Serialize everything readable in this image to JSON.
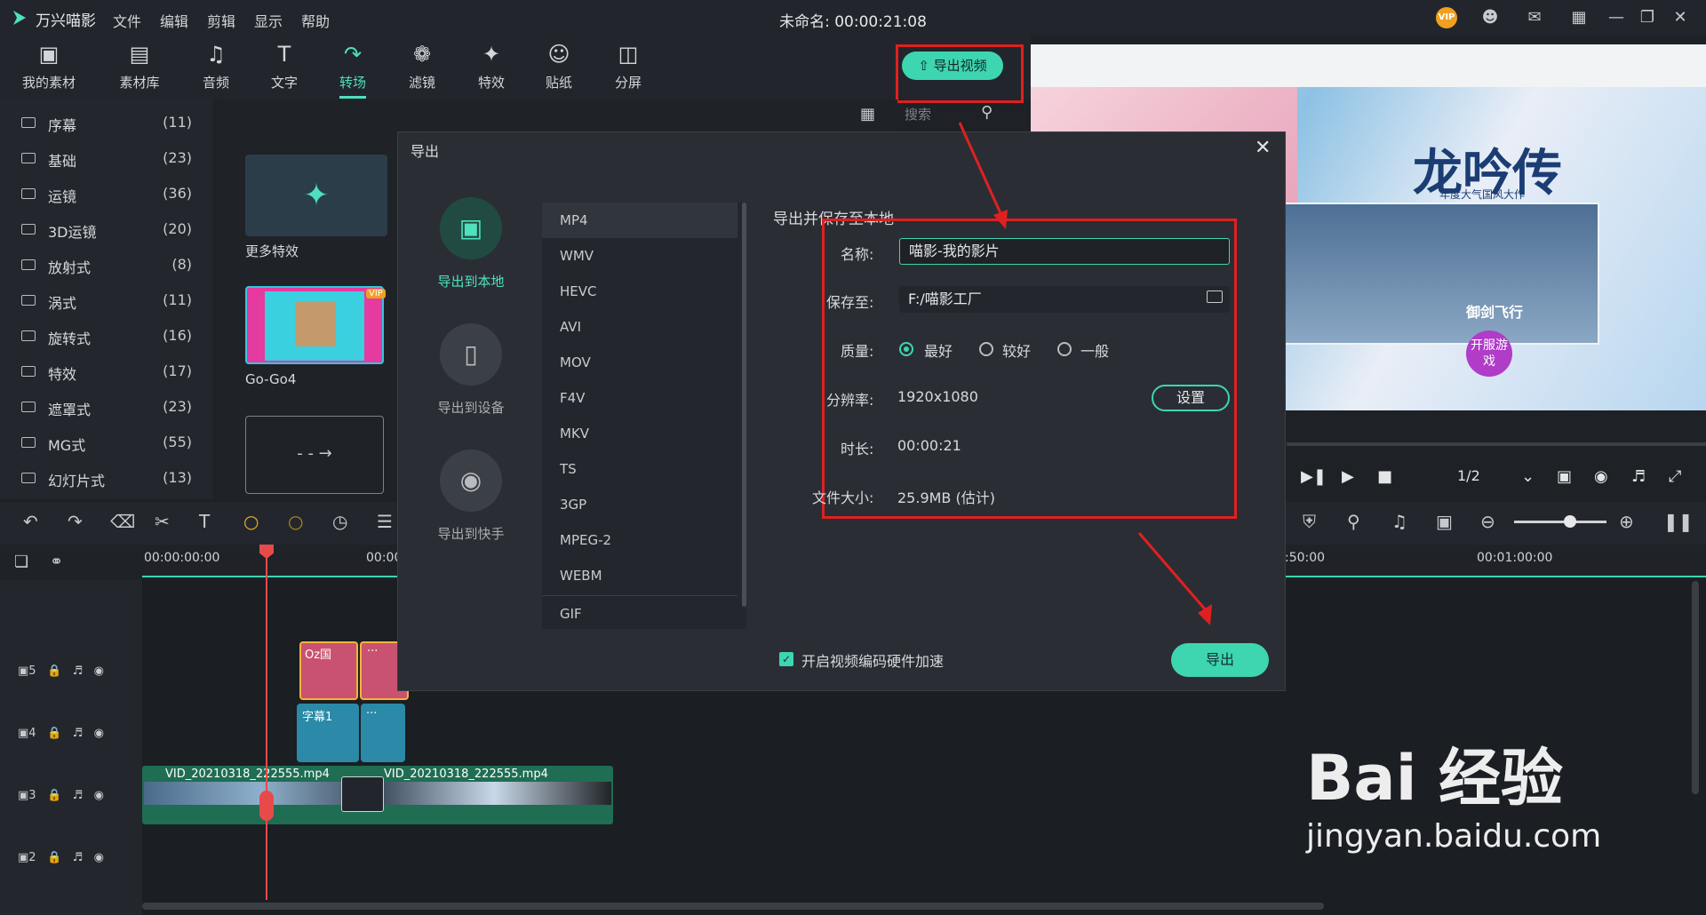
{
  "app": {
    "brand": "万兴喵影",
    "menu": [
      "文件",
      "编辑",
      "剪辑",
      "显示",
      "帮助"
    ],
    "title": "未命名: 00:00:21:08",
    "vip": "VIP"
  },
  "toolbar": {
    "items": [
      "我的素材",
      "素材库",
      "音频",
      "文字",
      "转场",
      "滤镜",
      "特效",
      "贴纸",
      "分屏"
    ],
    "active": "转场",
    "export_video": "导出视频",
    "search_placeholder": "搜索"
  },
  "categories": [
    {
      "name": "序幕",
      "count": "(11)"
    },
    {
      "name": "基础",
      "count": "(23)"
    },
    {
      "name": "运镜",
      "count": "(36)"
    },
    {
      "name": "3D运镜",
      "count": "(20)"
    },
    {
      "name": "放射式",
      "count": "(8)"
    },
    {
      "name": "涡式",
      "count": "(11)"
    },
    {
      "name": "旋转式",
      "count": "(16)"
    },
    {
      "name": "特效",
      "count": "(17)"
    },
    {
      "name": "遮罩式",
      "count": "(23)"
    },
    {
      "name": "MG式",
      "count": "(55)"
    },
    {
      "name": "幻灯片式",
      "count": "(13)"
    }
  ],
  "thumbs": {
    "more": "更多特效",
    "item1": "Go-Go4",
    "vip": "VIP"
  },
  "preview": {
    "title": "龙吟传",
    "subtitle": "年度大气国风大作",
    "caption": "御剑飞行",
    "badge": "开服游戏",
    "page": "1/2"
  },
  "timeline": {
    "start": "00:00:00:00",
    "t2": "00:00:",
    "t3": ":50:00",
    "t4": "00:01:00:00",
    "tracks": [
      "5",
      "4",
      "3",
      "2"
    ],
    "clip_transition": "Oz国",
    "clip_more": "···",
    "clip_text": "字幕1",
    "clip_video1": "VID_20210318_222555.mp4",
    "clip_video2": "VID_20210318_222555.mp4"
  },
  "dialog": {
    "title": "导出",
    "side": [
      "导出到本地",
      "导出到设备",
      "导出到快手"
    ],
    "formats": [
      "MP4",
      "WMV",
      "HEVC",
      "AVI",
      "MOV",
      "F4V",
      "MKV",
      "TS",
      "3GP",
      "MPEG-2",
      "WEBM",
      "GIF"
    ],
    "selected_format": "MP4",
    "section": "导出并保存至本地",
    "name_label": "名称:",
    "name_value": "喵影-我的影片",
    "save_label": "保存至:",
    "save_value": "F:/喵影工厂",
    "quality_label": "质量:",
    "quality_options": [
      "最好",
      "较好",
      "一般"
    ],
    "quality_selected": "最好",
    "res_label": "分辨率:",
    "res_value": "1920x1080",
    "settings": "设置",
    "dur_label": "时长:",
    "dur_value": "00:00:21",
    "size_label": "文件大小:",
    "size_value": "25.9MB (估计)",
    "hw_accel": "开启视频编码硬件加速",
    "export": "导出"
  },
  "watermark": {
    "brand": "Bai 经验",
    "url": "jingyan.baidu.com"
  },
  "colors": {
    "accent": "#3ed5b1",
    "highlight": "#e02020"
  }
}
